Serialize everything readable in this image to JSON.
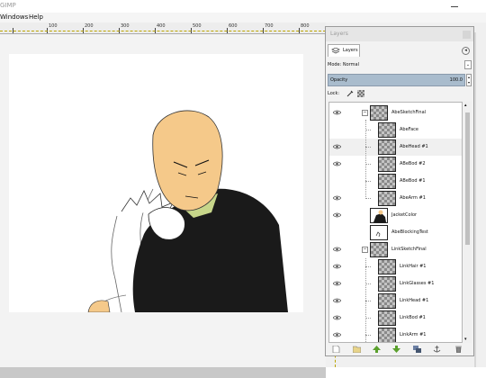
{
  "app": {
    "title": "GIMP"
  },
  "menubar": {
    "items": [
      "Windows",
      "Help"
    ]
  },
  "ruler": {
    "labels": [
      "100",
      "200",
      "300",
      "400",
      "500",
      "600",
      "700",
      "800"
    ]
  },
  "dock": {
    "title": "Layers",
    "tab_label": "Layers",
    "mode_label": "Mode: Normal",
    "opacity_label": "Opacity",
    "opacity_value": "100.0",
    "lock_label": "Lock:"
  },
  "layers": [
    {
      "name": "AbeSketchFinal",
      "group": true,
      "visible": true
    },
    {
      "name": "AbeFace",
      "visible": false
    },
    {
      "name": "AbeHead #1",
      "visible": true
    },
    {
      "name": "ABeBod #2",
      "visible": true
    },
    {
      "name": "ABeBod #1",
      "visible": false
    },
    {
      "name": "AbeArm #1",
      "visible": true
    },
    {
      "name": "JacketColor",
      "visible": true
    },
    {
      "name": "AbeBlockingTest",
      "visible": false
    },
    {
      "name": "LinkSketchFinal",
      "group": true,
      "visible": true
    },
    {
      "name": "LinkHair #1",
      "visible": true
    },
    {
      "name": "LinkGlasses #1",
      "visible": true
    },
    {
      "name": "LinkHead #1",
      "visible": true
    },
    {
      "name": "LinkBod #1",
      "visible": true
    },
    {
      "name": "LinkArm #1",
      "visible": true
    }
  ],
  "toolbar_icons": [
    "new-layer-icon",
    "new-group-icon",
    "raise-layer-icon",
    "lower-layer-icon",
    "duplicate-layer-icon",
    "anchor-layer-icon",
    "delete-layer-icon"
  ],
  "colors": {
    "opacity_bar": "#a9bccd",
    "skin": "#f5c98a",
    "jacket": "#1a1a1a",
    "collar": "#c7d68a"
  }
}
